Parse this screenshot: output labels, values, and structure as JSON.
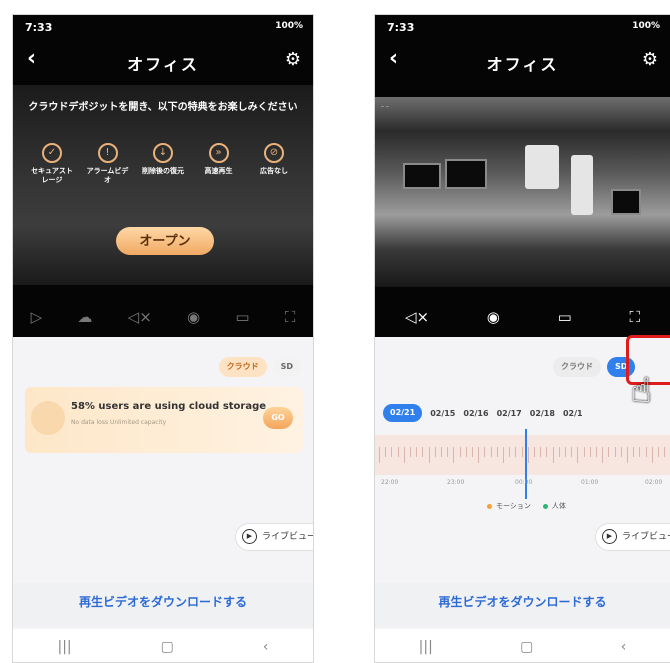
{
  "status": {
    "time": "7:33",
    "battery": "100%"
  },
  "nav": {
    "title": "オフィス"
  },
  "left": {
    "promo": "クラウドデポジットを開き、以下の特典をお楽しみください",
    "features": [
      {
        "label": "セキュアストレージ"
      },
      {
        "label": "アラームビデオ"
      },
      {
        "label": "削除後の復元"
      },
      {
        "label": "高速再生"
      },
      {
        "label": "広告なし"
      }
    ],
    "open_label": "オープン",
    "tabs": {
      "cloud": "クラウド",
      "sd": "SD"
    },
    "cloud_card": {
      "title": "58% users are using cloud storage",
      "subtitle": "No data loss Unlimited capacity",
      "go": "GO"
    }
  },
  "right": {
    "tabs": {
      "cloud": "クラウド",
      "sd": "SD"
    },
    "dates": {
      "active": "02/21",
      "items": [
        "02/15",
        "02/16",
        "02/17",
        "02/18",
        "02/1"
      ]
    },
    "times": [
      "22:00",
      "23:00",
      "00:00",
      "01:00",
      "02:00"
    ],
    "legend": {
      "motion": "モーション",
      "human": "人体"
    },
    "colors": {
      "motion": "#f4a234",
      "human": "#2bb673"
    }
  },
  "live_view": "ライブビュー",
  "download": "再生ビデオをダウンロードする"
}
